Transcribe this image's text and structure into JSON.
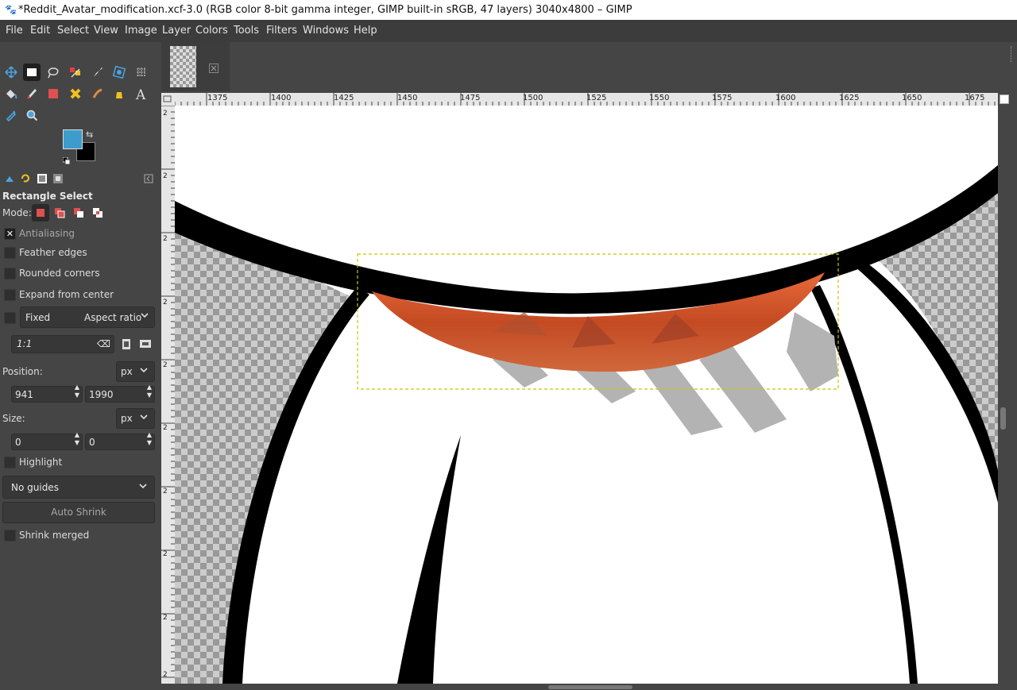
{
  "window": {
    "title": "*Reddit_Avatar_modification.xcf-3.0 (RGB color 8-bit gamma integer, GIMP built-in sRGB, 47 layers) 3040x4800 – GIMP"
  },
  "menu": [
    "File",
    "Edit",
    "Select",
    "View",
    "Image",
    "Layer",
    "Colors",
    "Tools",
    "Filters",
    "Windows",
    "Help"
  ],
  "colors": {
    "foreground": "#3d9ccc",
    "background": "#000000",
    "selection_outline": "#c8c800"
  },
  "tool_options": {
    "title": "Rectangle Select",
    "mode_label": "Mode:",
    "antialiasing": {
      "label": "Antialiasing",
      "checked": true
    },
    "feather_edges": {
      "label": "Feather edges",
      "checked": false
    },
    "rounded_corners": {
      "label": "Rounded corners",
      "checked": false
    },
    "expand_from_center": {
      "label": "Expand from center",
      "checked": false
    },
    "fixed": {
      "label": "Fixed",
      "value": "Aspect ratio",
      "checked": false
    },
    "ratio": "1:1",
    "position": {
      "label": "Position:",
      "unit": "px",
      "x": "941",
      "y": "1990"
    },
    "size": {
      "label": "Size:",
      "unit": "px",
      "w": "0",
      "h": "0"
    },
    "highlight": {
      "label": "Highlight",
      "checked": false
    },
    "guides": "No guides",
    "auto_shrink": "Auto Shrink",
    "shrink_merged": {
      "label": "Shrink merged",
      "checked": false
    }
  },
  "ruler": {
    "h_labels": [
      "1375",
      "1400",
      "1425",
      "1450",
      "1475",
      "1500",
      "1525",
      "1550",
      "1575",
      "1600",
      "1625",
      "1650",
      "1675"
    ],
    "v_labels": [
      "2",
      "2",
      "2",
      "2",
      "2",
      "2",
      "2",
      "2",
      "2",
      "2"
    ]
  },
  "tools": [
    "move-tool",
    "rect-select-tool",
    "lasso-tool",
    "fuzzy-select-tool",
    "paths-tool",
    "unified-transform-tool",
    "warp-tool",
    "bucket-fill-tool",
    "paintbrush-tool",
    "eraser-tool",
    "heal-tool",
    "smudge-tool",
    "dodge-tool",
    "text-tool",
    "color-picker-tool",
    "zoom-tool"
  ]
}
